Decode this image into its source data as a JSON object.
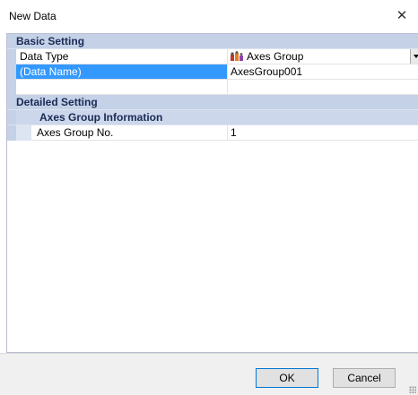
{
  "window": {
    "title": "New Data"
  },
  "grid": {
    "basic_setting": {
      "label": "Basic Setting",
      "data_type": {
        "name": "Data Type",
        "value": "Axes Group",
        "icon": "axes-group-icon"
      },
      "data_name": {
        "name": "(Data Name)",
        "value": "AxesGroup001"
      }
    },
    "detailed_setting": {
      "label": "Detailed Setting",
      "axes_group_information": {
        "label": "Axes Group Information",
        "axes_group_no": {
          "name": "Axes Group No.",
          "value": "1"
        }
      }
    }
  },
  "buttons": {
    "ok": "OK",
    "cancel": "Cancel"
  },
  "colors": {
    "category_bg": "#c4d1e7",
    "selection": "#3399ff"
  }
}
